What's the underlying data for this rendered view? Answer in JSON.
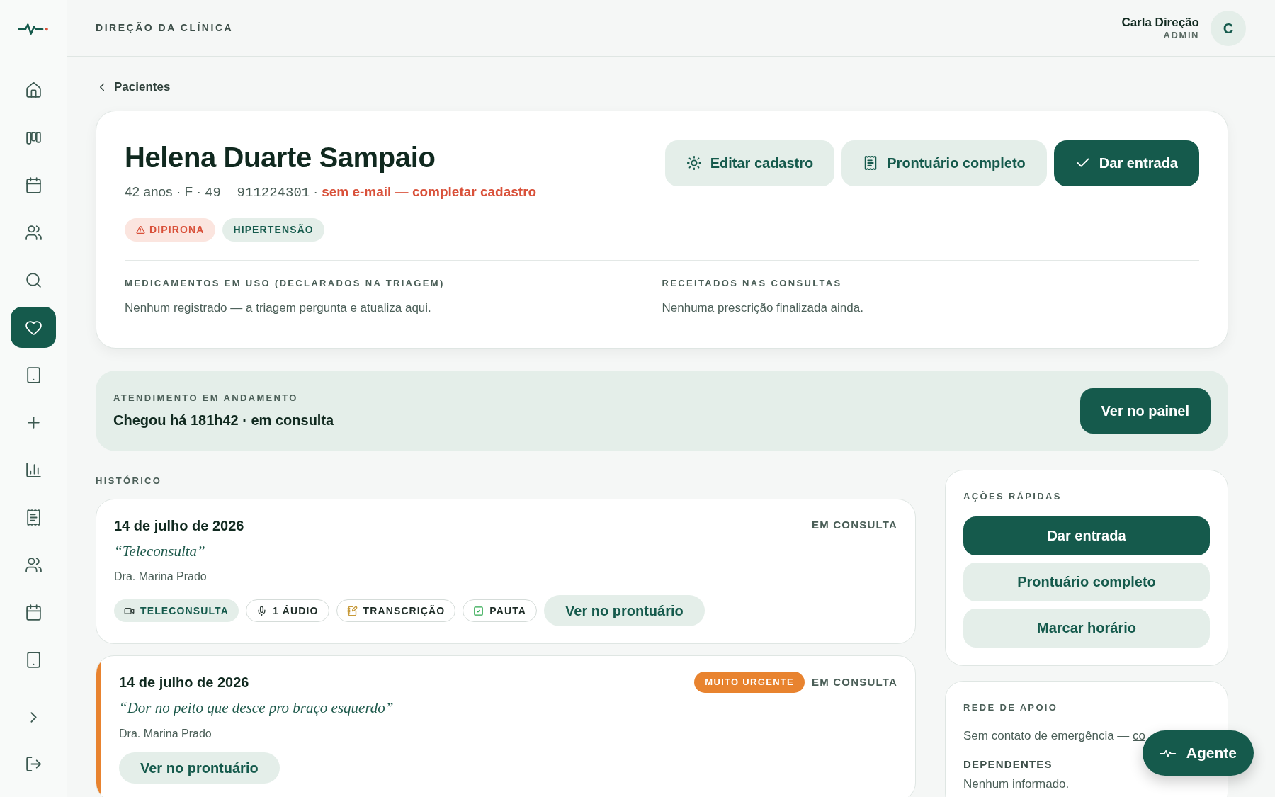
{
  "sidebar": {
    "items": [
      {
        "selected": false
      },
      {
        "selected": false
      },
      {
        "selected": false
      },
      {
        "selected": false
      },
      {
        "selected": false
      },
      {
        "selected": true
      },
      {
        "selected": false
      },
      {
        "selected": false
      },
      {
        "selected": false
      },
      {
        "selected": false
      },
      {
        "selected": false
      },
      {
        "selected": false
      },
      {
        "selected": false
      }
    ],
    "footer_items": [
      {
        "selected": false
      },
      {
        "selected": false
      }
    ]
  },
  "header": {
    "title": "DIREÇÃO DA CLÍNICA",
    "user_name": "Carla Direção",
    "user_role": "ADMIN",
    "avatar": "C"
  },
  "back_link": "Pacientes",
  "patient": {
    "name": "Helena Duarte Sampaio",
    "meta": "42 anos · F · ",
    "phone": "49  911224301",
    "separator": " · ",
    "warning": "sem e-mail — completar cadastro",
    "tags": [
      {
        "label": "DIPIRONA",
        "kind": "allergy"
      },
      {
        "label": "HIPERTENSÃO",
        "kind": "condition"
      }
    ],
    "actions": [
      {
        "label": "Editar cadastro",
        "kind": "edit",
        "primary": false
      },
      {
        "label": "Prontuário completo",
        "kind": "record",
        "primary": false
      },
      {
        "label": "Dar entrada",
        "kind": "check",
        "primary": true
      }
    ],
    "sections": [
      {
        "heading": "MEDICAMENTOS EM USO (DECLARADOS NA TRIAGEM)",
        "text": "Nenhum registrado — a triagem pergunta e atualiza aqui."
      },
      {
        "heading": "RECEITADOS NAS CONSULTAS",
        "text": "Nenhuma prescrição finalizada ainda."
      }
    ]
  },
  "current_visit": {
    "heading": "ATENDIMENTO EM ANDAMENTO",
    "text": "Chegou há 181h42 · em consulta",
    "button": "Ver no painel"
  },
  "history": {
    "heading": "HISTÓRICO",
    "items": [
      {
        "date": "14 de julho de 2026",
        "status": "EM CONSULTA",
        "quote": "“Teleconsulta”",
        "doctor": "Dra. Marina Prado",
        "chips": [
          {
            "label": "TELECONSULTA",
            "kind": "video",
            "highlighted": true
          },
          {
            "label": "1 ÁUDIO",
            "kind": "audio",
            "highlighted": false
          },
          {
            "label": "TRANSCRIÇÃO",
            "kind": "transcript",
            "highlighted": false
          },
          {
            "label": "PAUTA",
            "kind": "checklist",
            "highlighted": false
          }
        ],
        "button": "Ver no prontuário"
      },
      {
        "date": "14 de julho de 2026",
        "status": "EM CONSULTA",
        "urgency": {
          "label": "MUITO URGENTE",
          "color": "#e8832f"
        },
        "quote": "“Dor no peito que desce pro braço esquerdo”",
        "doctor": "Dra. Marina Prado",
        "button": "Ver no prontuário"
      }
    ]
  },
  "quick_actions": {
    "heading": "AÇÕES RÁPIDAS",
    "buttons": [
      {
        "label": "Dar entrada",
        "primary": true
      },
      {
        "label": "Prontuário completo",
        "primary": false
      },
      {
        "label": "Marcar horário",
        "primary": false
      }
    ]
  },
  "support": {
    "heading": "REDE DE APOIO",
    "text": "Sem contato de emergência — ",
    "link": "co",
    "dependents_heading": "DEPENDENTES",
    "dependents_text": "Nenhum informado."
  },
  "agent_button": "Agente"
}
